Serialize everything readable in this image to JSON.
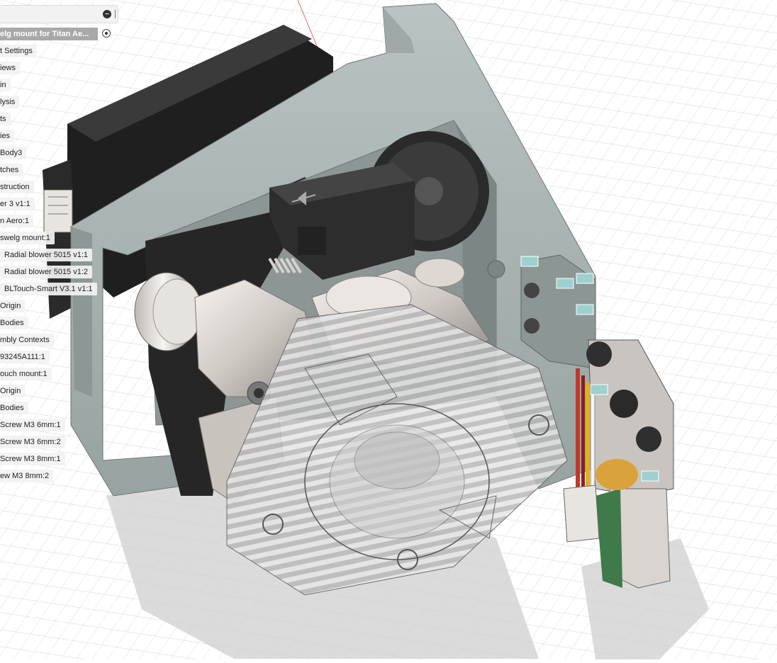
{
  "browser": {
    "root": {
      "label": "elg mount for Titan Ae..."
    },
    "items": [
      {
        "label": "t Settings"
      },
      {
        "label": "iews"
      },
      {
        "label": "in"
      },
      {
        "label": "lysis"
      },
      {
        "label": "ts"
      },
      {
        "label": "ies"
      },
      {
        "label": "Body3"
      },
      {
        "label": "tches"
      },
      {
        "label": "struction"
      },
      {
        "label": "er 3 v1:1"
      },
      {
        "label": "n Aero:1"
      },
      {
        "label": "swelg mount:1"
      },
      {
        "label": "Radial blower 5015 v1:1"
      },
      {
        "label": "Radial blower 5015 v1:2"
      },
      {
        "label": "BLTouch-Smart V3.1 v1:1"
      },
      {
        "label": "Origin"
      },
      {
        "label": "Bodies"
      },
      {
        "label": "mbly Contexts"
      },
      {
        "label": "93245A111:1"
      },
      {
        "label": "ouch mount:1"
      },
      {
        "label": "Origin"
      },
      {
        "label": "Bodies"
      },
      {
        "label": "Screw M3 6mm:1"
      },
      {
        "label": "Screw M3 6mm:2"
      },
      {
        "label": "Screw M3 8mm:1"
      },
      {
        "label": "ew M3 8mm:2"
      }
    ]
  },
  "icons": {
    "collapse": "minus-circle-icon",
    "active_component": "radio-dot-icon",
    "joint": "joint-glyph-icon"
  },
  "colors": {
    "canvas": "#ffffff",
    "grid_line": "#d9d9d9",
    "axis_red": "#e07070",
    "mount_grey": "#a9b5b3",
    "motor_black": "#1f1f1f",
    "fan_transparent": "#c9c9c9",
    "board_green": "#3f7a4a",
    "wire_red": "#c0392b",
    "wire_yellow": "#e0b020"
  }
}
